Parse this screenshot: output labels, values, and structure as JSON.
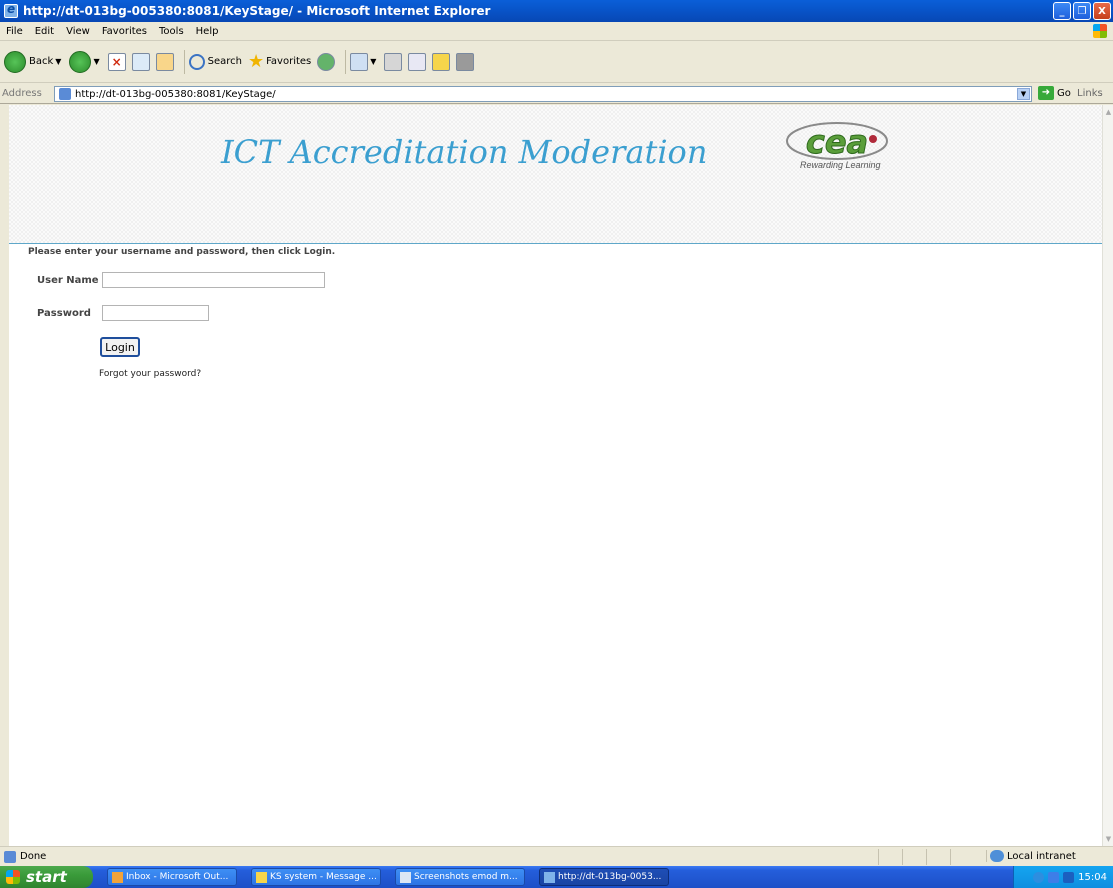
{
  "window": {
    "title": "http://dt-013bg-005380:8081/KeyStage/ - Microsoft Internet Explorer",
    "minimize": "_",
    "maximize": "❐",
    "close": "X"
  },
  "menu": {
    "items": [
      "File",
      "Edit",
      "View",
      "Favorites",
      "Tools",
      "Help"
    ]
  },
  "toolbar": {
    "back_label": "Back",
    "search_label": "Search",
    "favorites_label": "Favorites"
  },
  "address": {
    "label": "Address",
    "url": "http://dt-013bg-005380:8081/KeyStage/",
    "go_label": "Go",
    "links_label": "Links"
  },
  "page": {
    "title": "ICT Accreditation Moderation",
    "logo_text": "cea",
    "tagline": "Rewarding Learning",
    "instructions": "Please enter your username and password, then click Login.",
    "username_label": "User Name",
    "username_value": "",
    "password_label": "Password",
    "password_value": "",
    "login_label": "Login",
    "forgot_label": "Forgot your password?"
  },
  "statusbar": {
    "status": "Done",
    "zone": "Local intranet"
  },
  "taskbar": {
    "start_label": "start",
    "tasks": [
      {
        "label": "Inbox - Microsoft Out...",
        "color": "#f2a33a"
      },
      {
        "label": "KS system - Message ...",
        "color": "#f6d54b"
      },
      {
        "label": "Screenshots emod m...",
        "color": "#dce6f4"
      },
      {
        "label": "http://dt-013bg-0053...",
        "color": "#7fb3ea"
      }
    ],
    "clock": "15:04"
  },
  "colors": {
    "title_blue": "#3b9fd0",
    "header_rule": "#5fa7c9",
    "logo_green": "#5a9e3a",
    "logo_red": "#b02a3a"
  }
}
